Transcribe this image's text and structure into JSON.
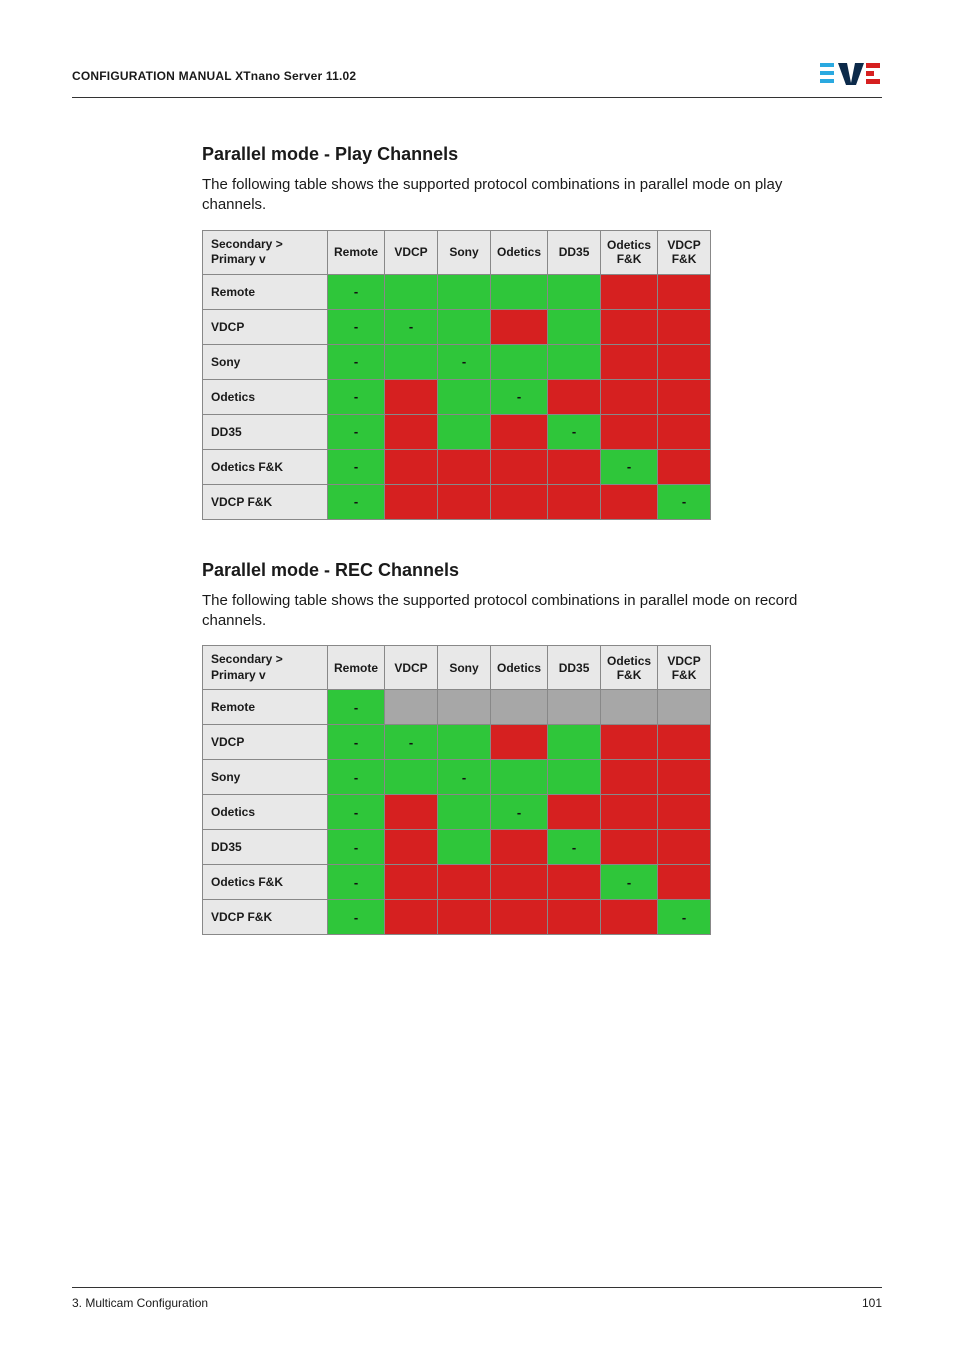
{
  "header": {
    "title": "CONFIGURATION MANUAL  XTnano Server 11.02"
  },
  "footer": {
    "left": "3. Multicam Configuration",
    "right": "101"
  },
  "labels": {
    "axis": "Secondary >\nPrimary v",
    "cols": [
      "Remote",
      "VDCP",
      "Sony",
      "Odetics",
      "DD35",
      "Odetics F&K",
      "VDCP F&K"
    ],
    "rows": [
      "Remote",
      "VDCP",
      "Sony",
      "Odetics",
      "DD35",
      "Odetics F&K",
      "VDCP F&K"
    ]
  },
  "sections": {
    "play": {
      "title": "Parallel mode - Play Channels",
      "intro": "The following table shows the supported protocol combinations in parallel mode on play channels.",
      "cells": [
        [
          [
            "-",
            "green"
          ],
          [
            "",
            "green"
          ],
          [
            "",
            "green"
          ],
          [
            "",
            "green"
          ],
          [
            "",
            "green"
          ],
          [
            "",
            "red"
          ],
          [
            "",
            "red"
          ]
        ],
        [
          [
            "-",
            "green"
          ],
          [
            "-",
            "green"
          ],
          [
            "",
            "green"
          ],
          [
            "",
            "red"
          ],
          [
            "",
            "green"
          ],
          [
            "",
            "red"
          ],
          [
            "",
            "red"
          ]
        ],
        [
          [
            "-",
            "green"
          ],
          [
            "",
            "green"
          ],
          [
            "-",
            "green"
          ],
          [
            "",
            "green"
          ],
          [
            "",
            "green"
          ],
          [
            "",
            "red"
          ],
          [
            "",
            "red"
          ]
        ],
        [
          [
            "-",
            "green"
          ],
          [
            "",
            "red"
          ],
          [
            "",
            "green"
          ],
          [
            "-",
            "green"
          ],
          [
            "",
            "red"
          ],
          [
            "",
            "red"
          ],
          [
            "",
            "red"
          ]
        ],
        [
          [
            "-",
            "green"
          ],
          [
            "",
            "red"
          ],
          [
            "",
            "green"
          ],
          [
            "",
            "red"
          ],
          [
            "-",
            "green"
          ],
          [
            "",
            "red"
          ],
          [
            "",
            "red"
          ]
        ],
        [
          [
            "-",
            "green"
          ],
          [
            "",
            "red"
          ],
          [
            "",
            "red"
          ],
          [
            "",
            "red"
          ],
          [
            "",
            "red"
          ],
          [
            "-",
            "green"
          ],
          [
            "",
            "red"
          ]
        ],
        [
          [
            "-",
            "green"
          ],
          [
            "",
            "red"
          ],
          [
            "",
            "red"
          ],
          [
            "",
            "red"
          ],
          [
            "",
            "red"
          ],
          [
            "",
            "red"
          ],
          [
            "-",
            "green"
          ]
        ]
      ]
    },
    "rec": {
      "title": "Parallel mode - REC Channels",
      "intro": "The following table shows the supported protocol combinations in parallel mode on record channels.",
      "cells": [
        [
          [
            "-",
            "green"
          ],
          [
            "",
            "gray"
          ],
          [
            "",
            "gray"
          ],
          [
            "",
            "gray"
          ],
          [
            "",
            "gray"
          ],
          [
            "",
            "gray"
          ],
          [
            "",
            "gray"
          ]
        ],
        [
          [
            "-",
            "green"
          ],
          [
            "-",
            "green"
          ],
          [
            "",
            "green"
          ],
          [
            "",
            "red"
          ],
          [
            "",
            "green"
          ],
          [
            "",
            "red"
          ],
          [
            "",
            "red"
          ]
        ],
        [
          [
            "-",
            "green"
          ],
          [
            "",
            "green"
          ],
          [
            "-",
            "green"
          ],
          [
            "",
            "green"
          ],
          [
            "",
            "green"
          ],
          [
            "",
            "red"
          ],
          [
            "",
            "red"
          ]
        ],
        [
          [
            "-",
            "green"
          ],
          [
            "",
            "red"
          ],
          [
            "",
            "green"
          ],
          [
            "-",
            "green"
          ],
          [
            "",
            "red"
          ],
          [
            "",
            "red"
          ],
          [
            "",
            "red"
          ]
        ],
        [
          [
            "-",
            "green"
          ],
          [
            "",
            "red"
          ],
          [
            "",
            "green"
          ],
          [
            "",
            "red"
          ],
          [
            "-",
            "green"
          ],
          [
            "",
            "red"
          ],
          [
            "",
            "red"
          ]
        ],
        [
          [
            "-",
            "green"
          ],
          [
            "",
            "red"
          ],
          [
            "",
            "red"
          ],
          [
            "",
            "red"
          ],
          [
            "",
            "red"
          ],
          [
            "-",
            "green"
          ],
          [
            "",
            "red"
          ]
        ],
        [
          [
            "-",
            "green"
          ],
          [
            "",
            "red"
          ],
          [
            "",
            "red"
          ],
          [
            "",
            "red"
          ],
          [
            "",
            "red"
          ],
          [
            "",
            "red"
          ],
          [
            "-",
            "green"
          ]
        ]
      ]
    }
  }
}
